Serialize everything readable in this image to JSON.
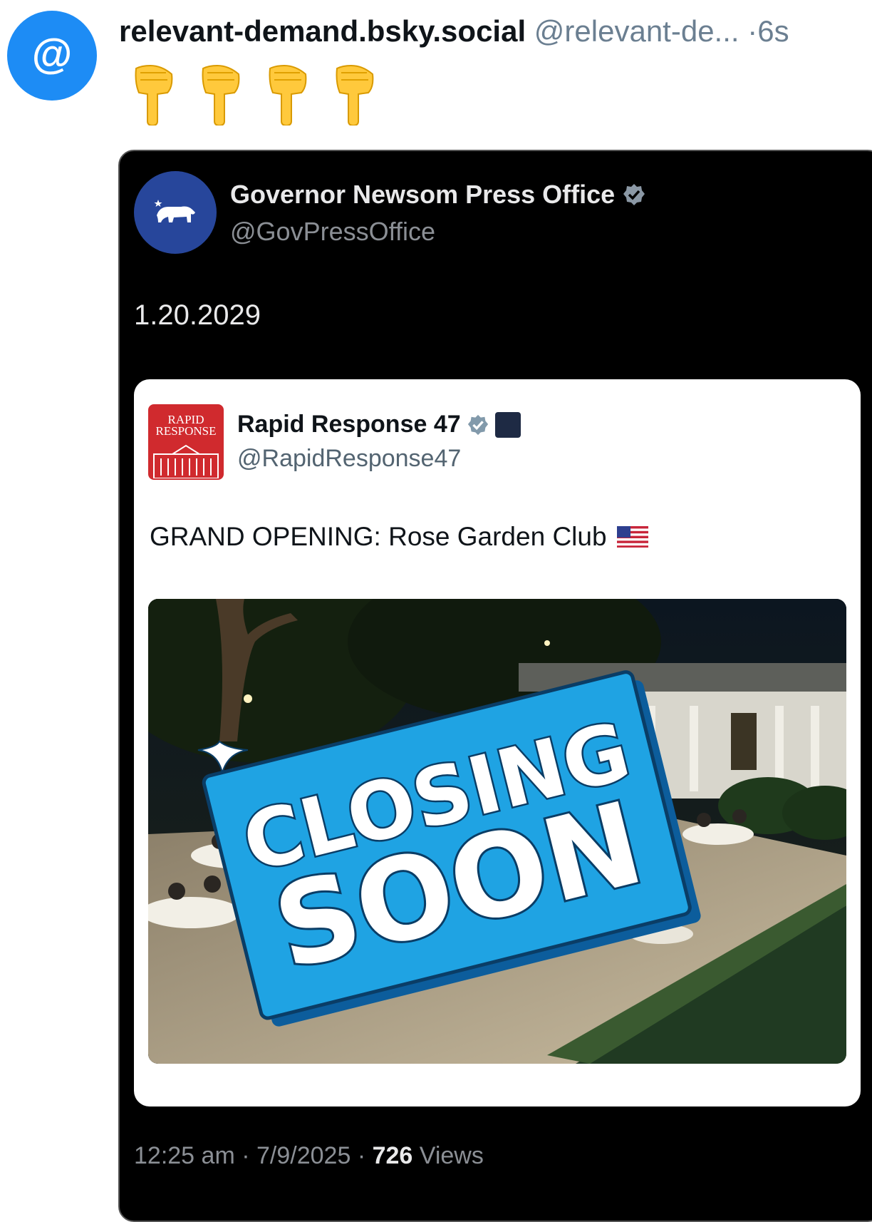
{
  "post": {
    "avatar_glyph": "@",
    "display_name": "relevant-demand.bsky.social",
    "handle": "@relevant-de...",
    "separator": "·",
    "age": "6s",
    "emoji_count": 4
  },
  "quoted_screenshot": {
    "author": {
      "name": "Governor Newsom Press Office",
      "handle": "@GovPressOffice",
      "verified": true
    },
    "text": "1.20.2029",
    "embedded_post": {
      "logo_text": "RAPID RESPONSE",
      "name": "Rapid Response 47",
      "handle": "@RapidResponse47",
      "verified": true,
      "text": "GRAND OPENING: Rose Garden Club",
      "image_overlay": {
        "line1": "CLOSING",
        "line2": "SOON"
      }
    },
    "footer": {
      "time": "12:25 am",
      "date": "7/9/2025",
      "views_count": "726",
      "views_label": "Views"
    }
  },
  "colors": {
    "bsky_blue": "#1d8cf5",
    "sign_blue": "#1fa3e3",
    "rr_red": "#d02a2e",
    "gov_blue": "#27469b"
  }
}
